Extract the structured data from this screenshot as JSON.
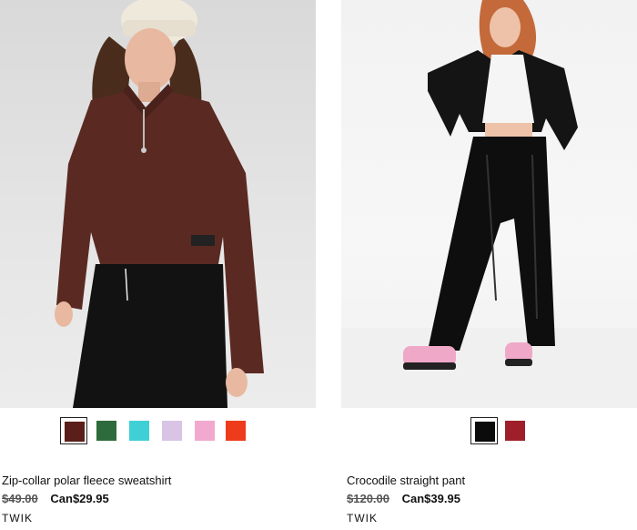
{
  "products": [
    {
      "name": "Zip-collar polar fleece sweatshirt",
      "old_price": "$49.00",
      "new_price": "Can$29.95",
      "brand": "TWIK",
      "swatches": [
        {
          "color": "#5a1f1a",
          "selected": true
        },
        {
          "color": "#2e6b3c",
          "selected": false
        },
        {
          "color": "#3fd0d6",
          "selected": false
        },
        {
          "color": "#d9c4e6",
          "selected": false
        },
        {
          "color": "#f2a9cf",
          "selected": false
        },
        {
          "color": "#ee3b1c",
          "selected": false
        }
      ]
    },
    {
      "name": "Crocodile straight pant",
      "old_price": "$120.00",
      "new_price": "Can$39.95",
      "brand": "TWIK",
      "swatches": [
        {
          "color": "#0b0b0b",
          "selected": true
        },
        {
          "color": "#9e1f2a",
          "selected": false
        }
      ]
    }
  ]
}
